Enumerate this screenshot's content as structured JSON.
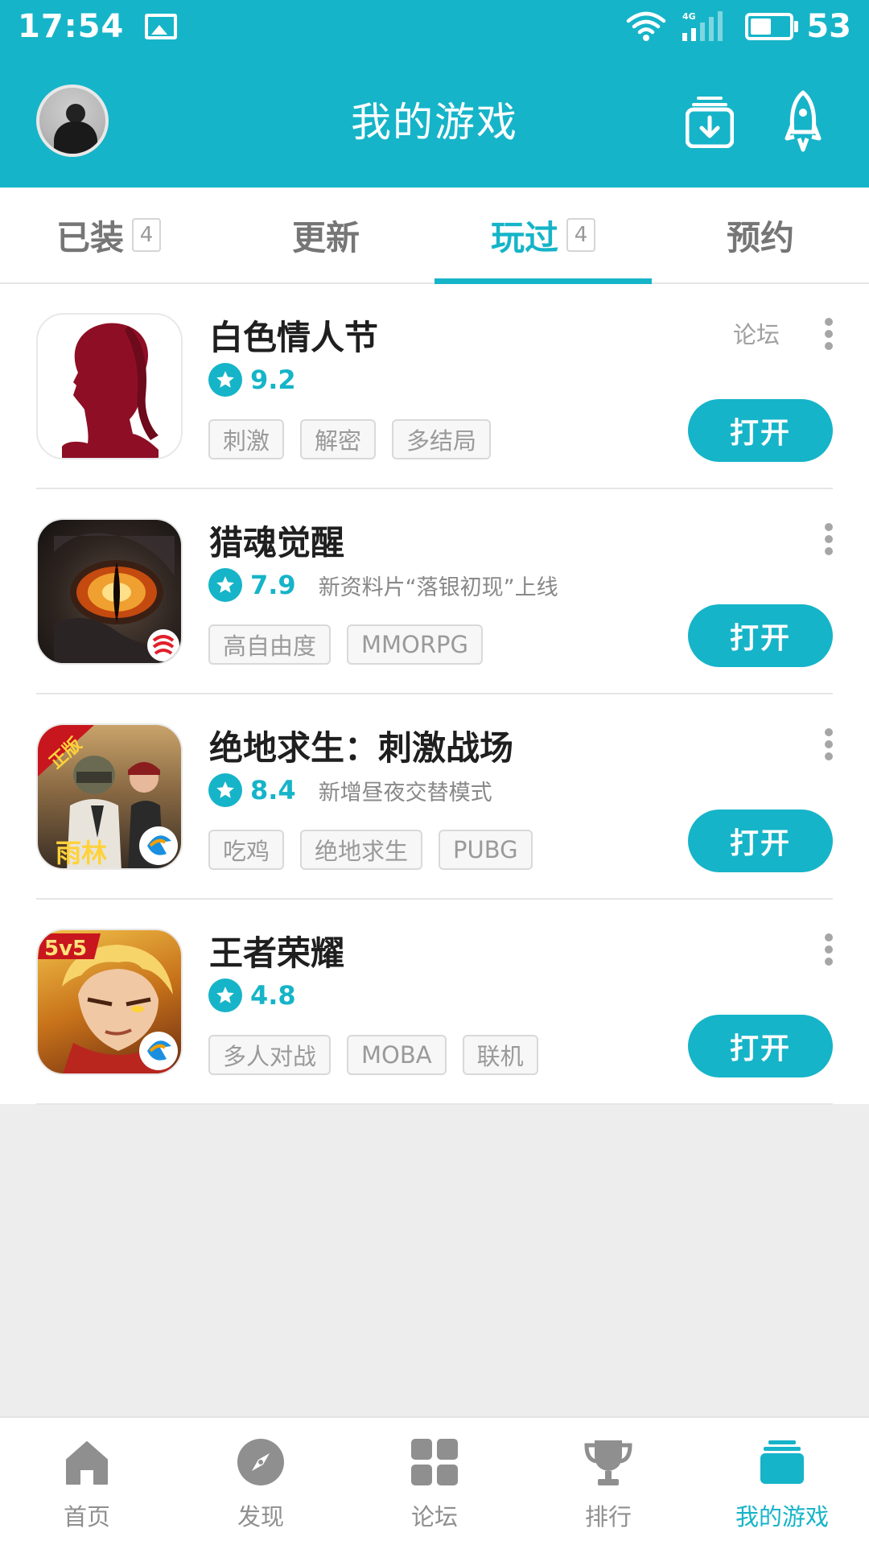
{
  "status_bar": {
    "time": "17:54",
    "battery": "53",
    "network": "4G"
  },
  "header": {
    "title": "我的游戏"
  },
  "tabs": [
    {
      "label": "已装",
      "count": "4"
    },
    {
      "label": "更新",
      "count": ""
    },
    {
      "label": "玩过",
      "count": "4"
    },
    {
      "label": "预约",
      "count": ""
    }
  ],
  "games": [
    {
      "name": "白色情人节",
      "score": "9.2",
      "desc": "",
      "tags": [
        "刺激",
        "解密",
        "多结局"
      ],
      "forum": "论坛",
      "action": "打开"
    },
    {
      "name": "猎魂觉醒",
      "score": "7.9",
      "desc": "新资料片“落银初现”上线",
      "tags": [
        "高自由度",
        "MMORPG"
      ],
      "action": "打开"
    },
    {
      "name": "绝地求生：刺激战场",
      "score": "8.4",
      "desc": "新增昼夜交替模式",
      "tags": [
        "吃鸡",
        "绝地求生",
        "PUBG"
      ],
      "action": "打开",
      "icon_badge": "正版",
      "icon_caption": "雨林"
    },
    {
      "name": "王者荣耀",
      "score": "4.8",
      "desc": "",
      "tags": [
        "多人对战",
        "MOBA",
        "联机"
      ],
      "action": "打开",
      "icon_badge": "5v5"
    }
  ],
  "nav": [
    {
      "label": "首页",
      "icon": "home-icon"
    },
    {
      "label": "发现",
      "icon": "compass-icon"
    },
    {
      "label": "论坛",
      "icon": "grid-icon"
    },
    {
      "label": "排行",
      "icon": "trophy-icon"
    },
    {
      "label": "我的游戏",
      "icon": "stack-icon",
      "active": true
    }
  ],
  "colors": {
    "accent": "#16b4c8",
    "inactive": "#8f8f8f"
  }
}
